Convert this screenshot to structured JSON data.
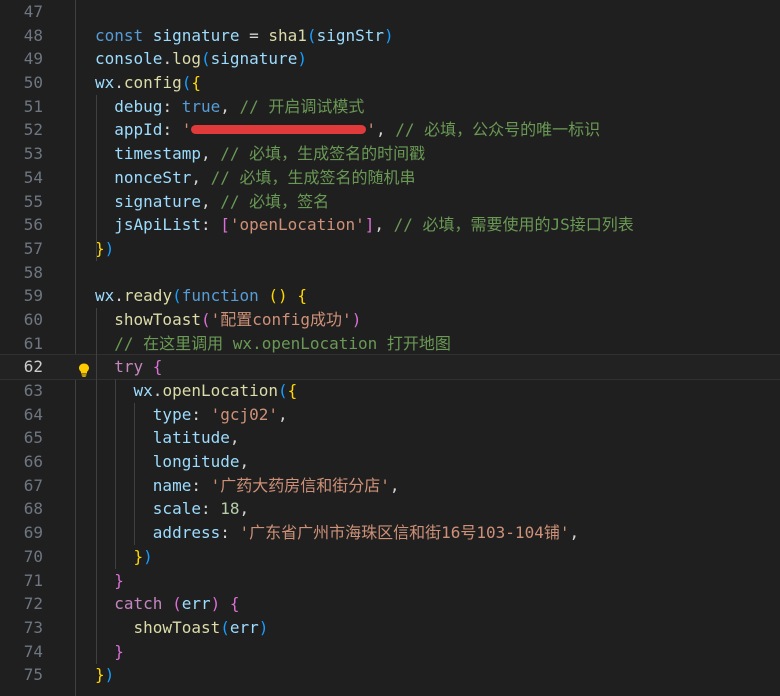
{
  "editor": {
    "lines": [
      {
        "n": "47",
        "t": []
      },
      {
        "n": "48",
        "t": [
          [
            "k",
            "const "
          ],
          [
            "v",
            "signature "
          ],
          [
            "w",
            "= "
          ],
          [
            "f",
            "sha1"
          ],
          [
            "p3",
            "("
          ],
          [
            "v",
            "signStr"
          ],
          [
            "p3",
            ")"
          ]
        ]
      },
      {
        "n": "49",
        "t": [
          [
            "v",
            "console"
          ],
          [
            "w",
            "."
          ],
          [
            "f",
            "log"
          ],
          [
            "p3",
            "("
          ],
          [
            "v",
            "signature"
          ],
          [
            "p3",
            ")"
          ]
        ]
      },
      {
        "n": "50",
        "t": [
          [
            "v",
            "wx"
          ],
          [
            "w",
            "."
          ],
          [
            "f",
            "config"
          ],
          [
            "p3",
            "("
          ],
          [
            "p1",
            "{"
          ]
        ]
      },
      {
        "n": "51",
        "t": [
          [
            "w",
            "  "
          ],
          [
            "v",
            "debug"
          ],
          [
            "w",
            ": "
          ],
          [
            "k",
            "true"
          ],
          [
            "w",
            ", "
          ],
          [
            "cm",
            "// 开启调试模式"
          ]
        ]
      },
      {
        "n": "52",
        "t": [
          [
            "w",
            "  "
          ],
          [
            "v",
            "appId"
          ],
          [
            "w",
            ": "
          ],
          [
            "s",
            "'"
          ],
          [
            "redact",
            ""
          ],
          [
            "s",
            "'"
          ],
          [
            "w",
            ", "
          ],
          [
            "cm",
            "// 必填，公众号的唯一标识"
          ]
        ]
      },
      {
        "n": "53",
        "t": [
          [
            "w",
            "  "
          ],
          [
            "v",
            "timestamp"
          ],
          [
            "w",
            ", "
          ],
          [
            "cm",
            "// 必填，生成签名的时间戳"
          ]
        ]
      },
      {
        "n": "54",
        "t": [
          [
            "w",
            "  "
          ],
          [
            "v",
            "nonceStr"
          ],
          [
            "w",
            ", "
          ],
          [
            "cm",
            "// 必填，生成签名的随机串"
          ]
        ]
      },
      {
        "n": "55",
        "t": [
          [
            "w",
            "  "
          ],
          [
            "v",
            "signature"
          ],
          [
            "w",
            ", "
          ],
          [
            "cm",
            "// 必填，签名"
          ]
        ]
      },
      {
        "n": "56",
        "t": [
          [
            "w",
            "  "
          ],
          [
            "v",
            "jsApiList"
          ],
          [
            "w",
            ": "
          ],
          [
            "p2",
            "["
          ],
          [
            "s",
            "'openLocation'"
          ],
          [
            "p2",
            "]"
          ],
          [
            "w",
            ", "
          ],
          [
            "cm",
            "// 必填，需要使用的JS接口列表"
          ]
        ]
      },
      {
        "n": "57",
        "t": [
          [
            "p1",
            "}"
          ],
          [
            "p3",
            ")"
          ]
        ]
      },
      {
        "n": "58",
        "t": []
      },
      {
        "n": "59",
        "t": [
          [
            "v",
            "wx"
          ],
          [
            "w",
            "."
          ],
          [
            "f",
            "ready"
          ],
          [
            "p3",
            "("
          ],
          [
            "k",
            "function "
          ],
          [
            "p1",
            "() {"
          ]
        ]
      },
      {
        "n": "60",
        "t": [
          [
            "w",
            "  "
          ],
          [
            "f",
            "showToast"
          ],
          [
            "p2",
            "("
          ],
          [
            "s",
            "'配置config成功'"
          ],
          [
            "p2",
            ")"
          ]
        ]
      },
      {
        "n": "61",
        "t": [
          [
            "w",
            "  "
          ],
          [
            "cm",
            "// 在这里调用 wx.openLocation 打开地图"
          ]
        ]
      },
      {
        "n": "62",
        "t": [
          [
            "w",
            "  "
          ],
          [
            "c",
            "try "
          ],
          [
            "p2",
            "{"
          ]
        ]
      },
      {
        "n": "63",
        "t": [
          [
            "w",
            "    "
          ],
          [
            "v",
            "wx"
          ],
          [
            "w",
            "."
          ],
          [
            "f",
            "openLocation"
          ],
          [
            "p3",
            "("
          ],
          [
            "p1",
            "{"
          ]
        ]
      },
      {
        "n": "64",
        "t": [
          [
            "w",
            "      "
          ],
          [
            "v",
            "type"
          ],
          [
            "w",
            ": "
          ],
          [
            "s",
            "'gcj02'"
          ],
          [
            "w",
            ","
          ]
        ]
      },
      {
        "n": "65",
        "t": [
          [
            "w",
            "      "
          ],
          [
            "v",
            "latitude"
          ],
          [
            "w",
            ","
          ]
        ]
      },
      {
        "n": "66",
        "t": [
          [
            "w",
            "      "
          ],
          [
            "v",
            "longitude"
          ],
          [
            "w",
            ","
          ]
        ]
      },
      {
        "n": "67",
        "t": [
          [
            "w",
            "      "
          ],
          [
            "v",
            "name"
          ],
          [
            "w",
            ": "
          ],
          [
            "s",
            "'广药大药房信和街分店'"
          ],
          [
            "w",
            ","
          ]
        ]
      },
      {
        "n": "68",
        "t": [
          [
            "w",
            "      "
          ],
          [
            "v",
            "scale"
          ],
          [
            "w",
            ": "
          ],
          [
            "n",
            "18"
          ],
          [
            "w",
            ","
          ]
        ]
      },
      {
        "n": "69",
        "t": [
          [
            "w",
            "      "
          ],
          [
            "v",
            "address"
          ],
          [
            "w",
            ": "
          ],
          [
            "s",
            "'广东省广州市海珠区信和街16号103-104铺'"
          ],
          [
            "w",
            ","
          ]
        ]
      },
      {
        "n": "70",
        "t": [
          [
            "w",
            "    "
          ],
          [
            "p1",
            "}"
          ],
          [
            "p3",
            ")"
          ]
        ]
      },
      {
        "n": "71",
        "t": [
          [
            "w",
            "  "
          ],
          [
            "p2",
            "}"
          ]
        ]
      },
      {
        "n": "72",
        "t": [
          [
            "w",
            "  "
          ],
          [
            "c",
            "catch "
          ],
          [
            "p2",
            "("
          ],
          [
            "v",
            "err"
          ],
          [
            "p2",
            ") {"
          ]
        ]
      },
      {
        "n": "73",
        "t": [
          [
            "w",
            "    "
          ],
          [
            "f",
            "showToast"
          ],
          [
            "p3",
            "("
          ],
          [
            "v",
            "err"
          ],
          [
            "p3",
            ")"
          ]
        ]
      },
      {
        "n": "74",
        "t": [
          [
            "w",
            "  "
          ],
          [
            "p2",
            "}"
          ]
        ]
      },
      {
        "n": "75",
        "t": [
          [
            "p1",
            "}"
          ],
          [
            "p3",
            ")"
          ]
        ]
      }
    ],
    "current_line": "62"
  },
  "colors": {
    "background": "#1f1f1f",
    "keyword": "#569cd6",
    "control": "#c586c0",
    "variable": "#9cdcfe",
    "function": "#dcdcaa",
    "string": "#ce9178",
    "comment": "#6a9955",
    "number": "#b5cea8"
  },
  "icons": {
    "lightbulb": "lightbulb-icon"
  }
}
